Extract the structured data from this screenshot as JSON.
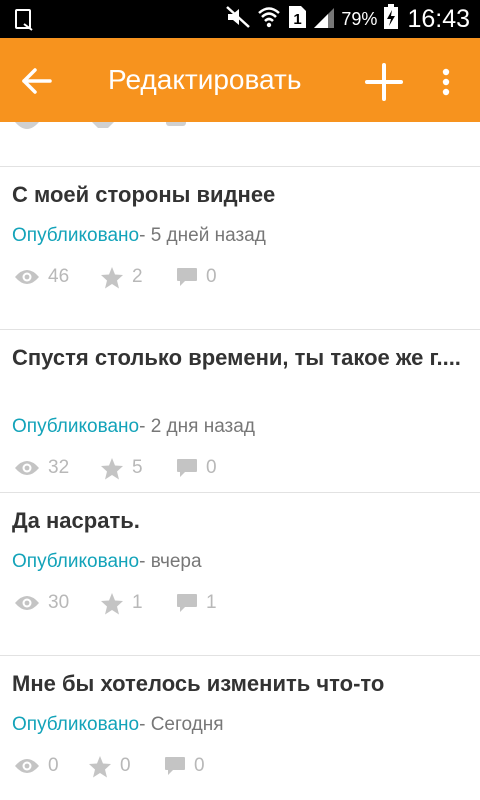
{
  "status_bar": {
    "battery": "79%",
    "time": "16:43",
    "sim": "1"
  },
  "toolbar": {
    "title": "Редактировать",
    "back_icon": "arrow-left-icon",
    "add_icon": "plus-icon",
    "more_icon": "more-vertical-icon"
  },
  "colors": {
    "toolbar": "#f7931e",
    "status_published": "#13a3b9",
    "stat_gray": "#b8b8b8"
  },
  "posts": [
    {
      "title": "С моей стороны виднее",
      "status": "Опубликовано",
      "date": "- 5 дней назад",
      "views": "46",
      "stars": "2",
      "comments": "0"
    },
    {
      "title": "Спустя столько времени, ты такое же г....",
      "status": "Опубликовано",
      "date": "- 2 дня назад",
      "views": "32",
      "stars": "5",
      "comments": "0"
    },
    {
      "title": "Да насрать.",
      "status": "Опубликовано",
      "date": "- вчера",
      "views": "30",
      "stars": "1",
      "comments": "1"
    },
    {
      "title": "Мне бы хотелось изменить что-то",
      "status": "Опубликовано",
      "date": "- Сегодня",
      "views": "0",
      "stars": "0",
      "comments": "0"
    }
  ]
}
